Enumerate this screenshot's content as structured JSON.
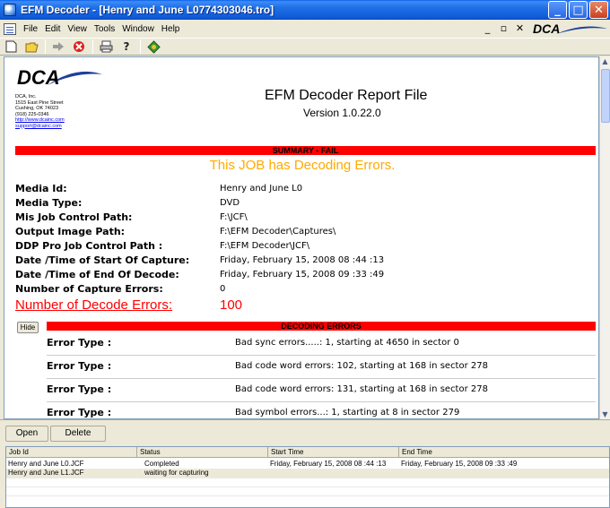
{
  "window": {
    "title": "EFM Decoder - [Henry and June L0774303046.tro]",
    "controls": [
      "minimize",
      "maximize",
      "close"
    ]
  },
  "menu": {
    "items": [
      {
        "label": "File"
      },
      {
        "label": "Edit"
      },
      {
        "label": "View"
      },
      {
        "label": "Tools"
      },
      {
        "label": "Window"
      },
      {
        "label": "Help"
      }
    ],
    "logo_text": "DCA"
  },
  "toolbar": {
    "icons": [
      "new-icon",
      "open-folder-icon",
      "go-arrow-icon",
      "stop-icon",
      "print-icon",
      "help-icon",
      "options-icon"
    ]
  },
  "report": {
    "logo_text": "DCA",
    "company": {
      "name": "DCA, Inc.",
      "address1": "1515 East Pine Street",
      "address2": "Cushing, OK 74023",
      "phone": "(918) 225-0346",
      "website": "http://www.dcainc.com",
      "email": "support@dcainc.com"
    },
    "title": "EFM Decoder Report File",
    "version": "Version 1.0.22.0",
    "summary_bar": "SUMMARY - FAIL",
    "summary_message": "This JOB has Decoding Errors.",
    "fields": [
      {
        "label": "Media Id:",
        "value": "Henry and June L0"
      },
      {
        "label": "Media Type:",
        "value": "DVD"
      },
      {
        "label": "Mis Job Control Path:",
        "value": "F:\\JCF\\"
      },
      {
        "label": "Output Image Path:",
        "value": "F:\\EFM Decoder\\Captures\\"
      },
      {
        "label": "DDP Pro Job Control Path :",
        "value": "F:\\EFM Decoder\\JCF\\"
      },
      {
        "label": "Date /Time of Start Of Capture:",
        "value": "Friday, February 15, 2008 08 :44 :13"
      },
      {
        "label": "Date /Time of End Of Decode:",
        "value": "Friday, February 15, 2008 09 :33 :49"
      },
      {
        "label": "Number of Capture Errors:",
        "value": "0"
      }
    ],
    "decode_errors_label": "Number of Decode Errors:",
    "decode_errors_value": "100",
    "hide_button": "Hide",
    "decoding_bar": "DECODING ERRORS",
    "errors": [
      {
        "type": "Error Type :",
        "desc": "Bad sync errors.....: 1, starting at 4650 in sector 0"
      },
      {
        "type": "Error Type :",
        "desc": "Bad code word errors: 102, starting at 168 in sector 278"
      },
      {
        "type": "Error Type :",
        "desc": "Bad code word errors: 131, starting at 168 in sector 278"
      },
      {
        "type": "Error Type :",
        "desc": "Bad symbol errors...: 1, starting at 8 in sector 279"
      }
    ]
  },
  "bottom": {
    "open_label": "Open",
    "delete_label": "Delete",
    "columns": [
      "Job Id",
      "Status",
      "Start Time",
      "End Time"
    ],
    "rows": [
      {
        "job": "Henry and June L0.JCF",
        "status": "Completed",
        "start": "Friday, February 15, 2008 08 :44 :13",
        "end": "Friday, February 15, 2008 09 :33 :49"
      },
      {
        "job": "Henry and June L1.JCF",
        "status": "waiting for capturing",
        "start": "",
        "end": ""
      }
    ]
  },
  "colors": {
    "title_bar": "#0f5ad8",
    "fail_red": "#ff0000",
    "summary_orange": "#ffaa00",
    "logo_blue": "#1e3f9a"
  }
}
